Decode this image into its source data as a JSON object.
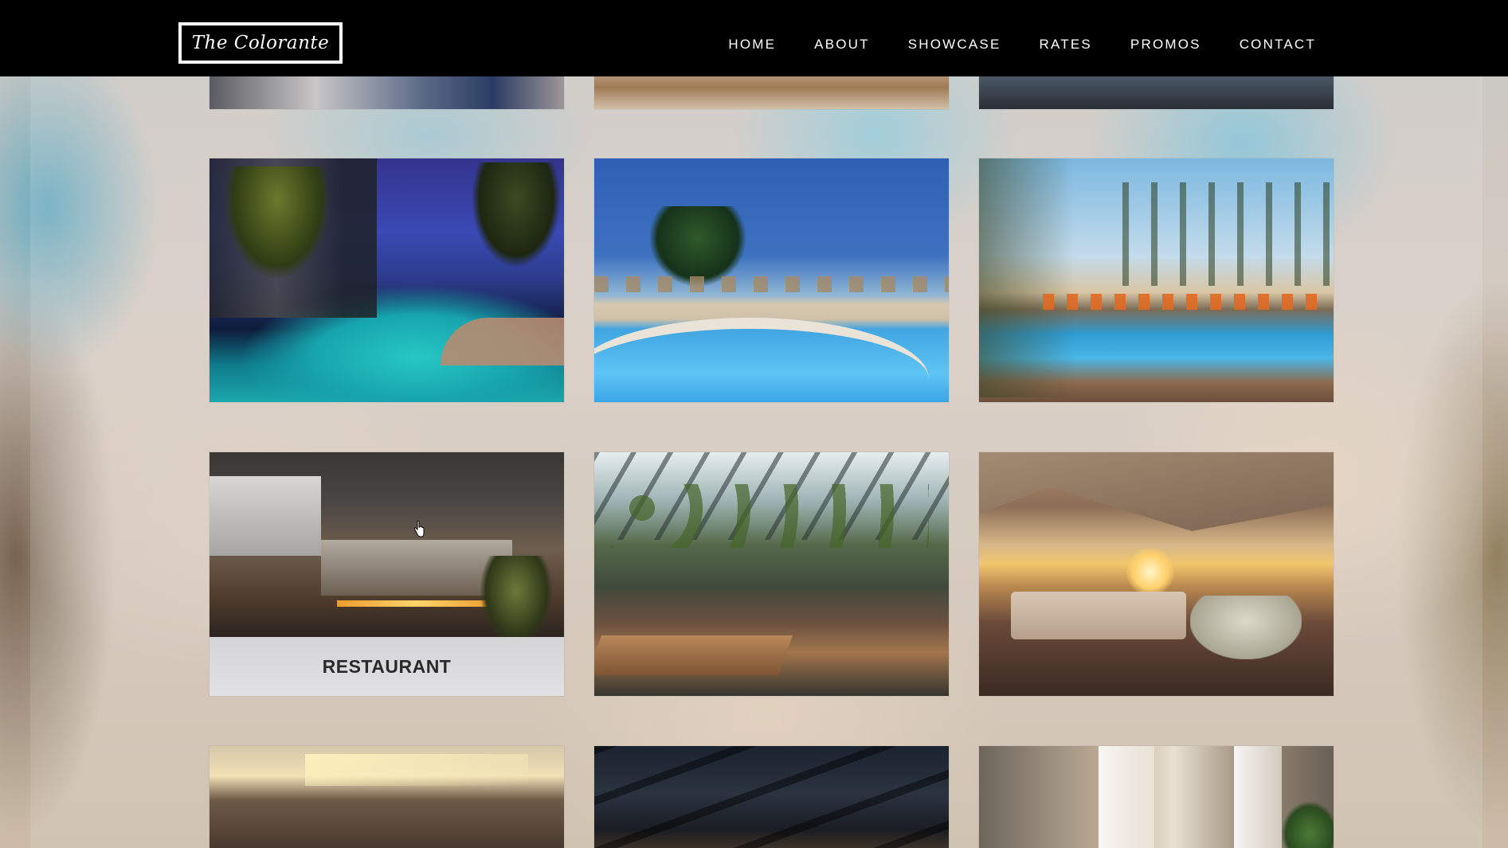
{
  "brand": {
    "logo_text": "The Colorante"
  },
  "nav": {
    "items": [
      {
        "label": "HOME"
      },
      {
        "label": "ABOUT"
      },
      {
        "label": "SHOWCASE"
      },
      {
        "label": "RATES"
      },
      {
        "label": "PROMOS"
      },
      {
        "label": "CONTACT"
      }
    ]
  },
  "gallery": {
    "hovered_caption": "RESTAURANT"
  },
  "colors": {
    "header_bg": "#000000",
    "nav_text": "#ffffff",
    "caption_bg": "#f0f0f2",
    "caption_text": "#2a2a2a"
  },
  "icons": {
    "cursor": "hand-pointer-icon"
  }
}
